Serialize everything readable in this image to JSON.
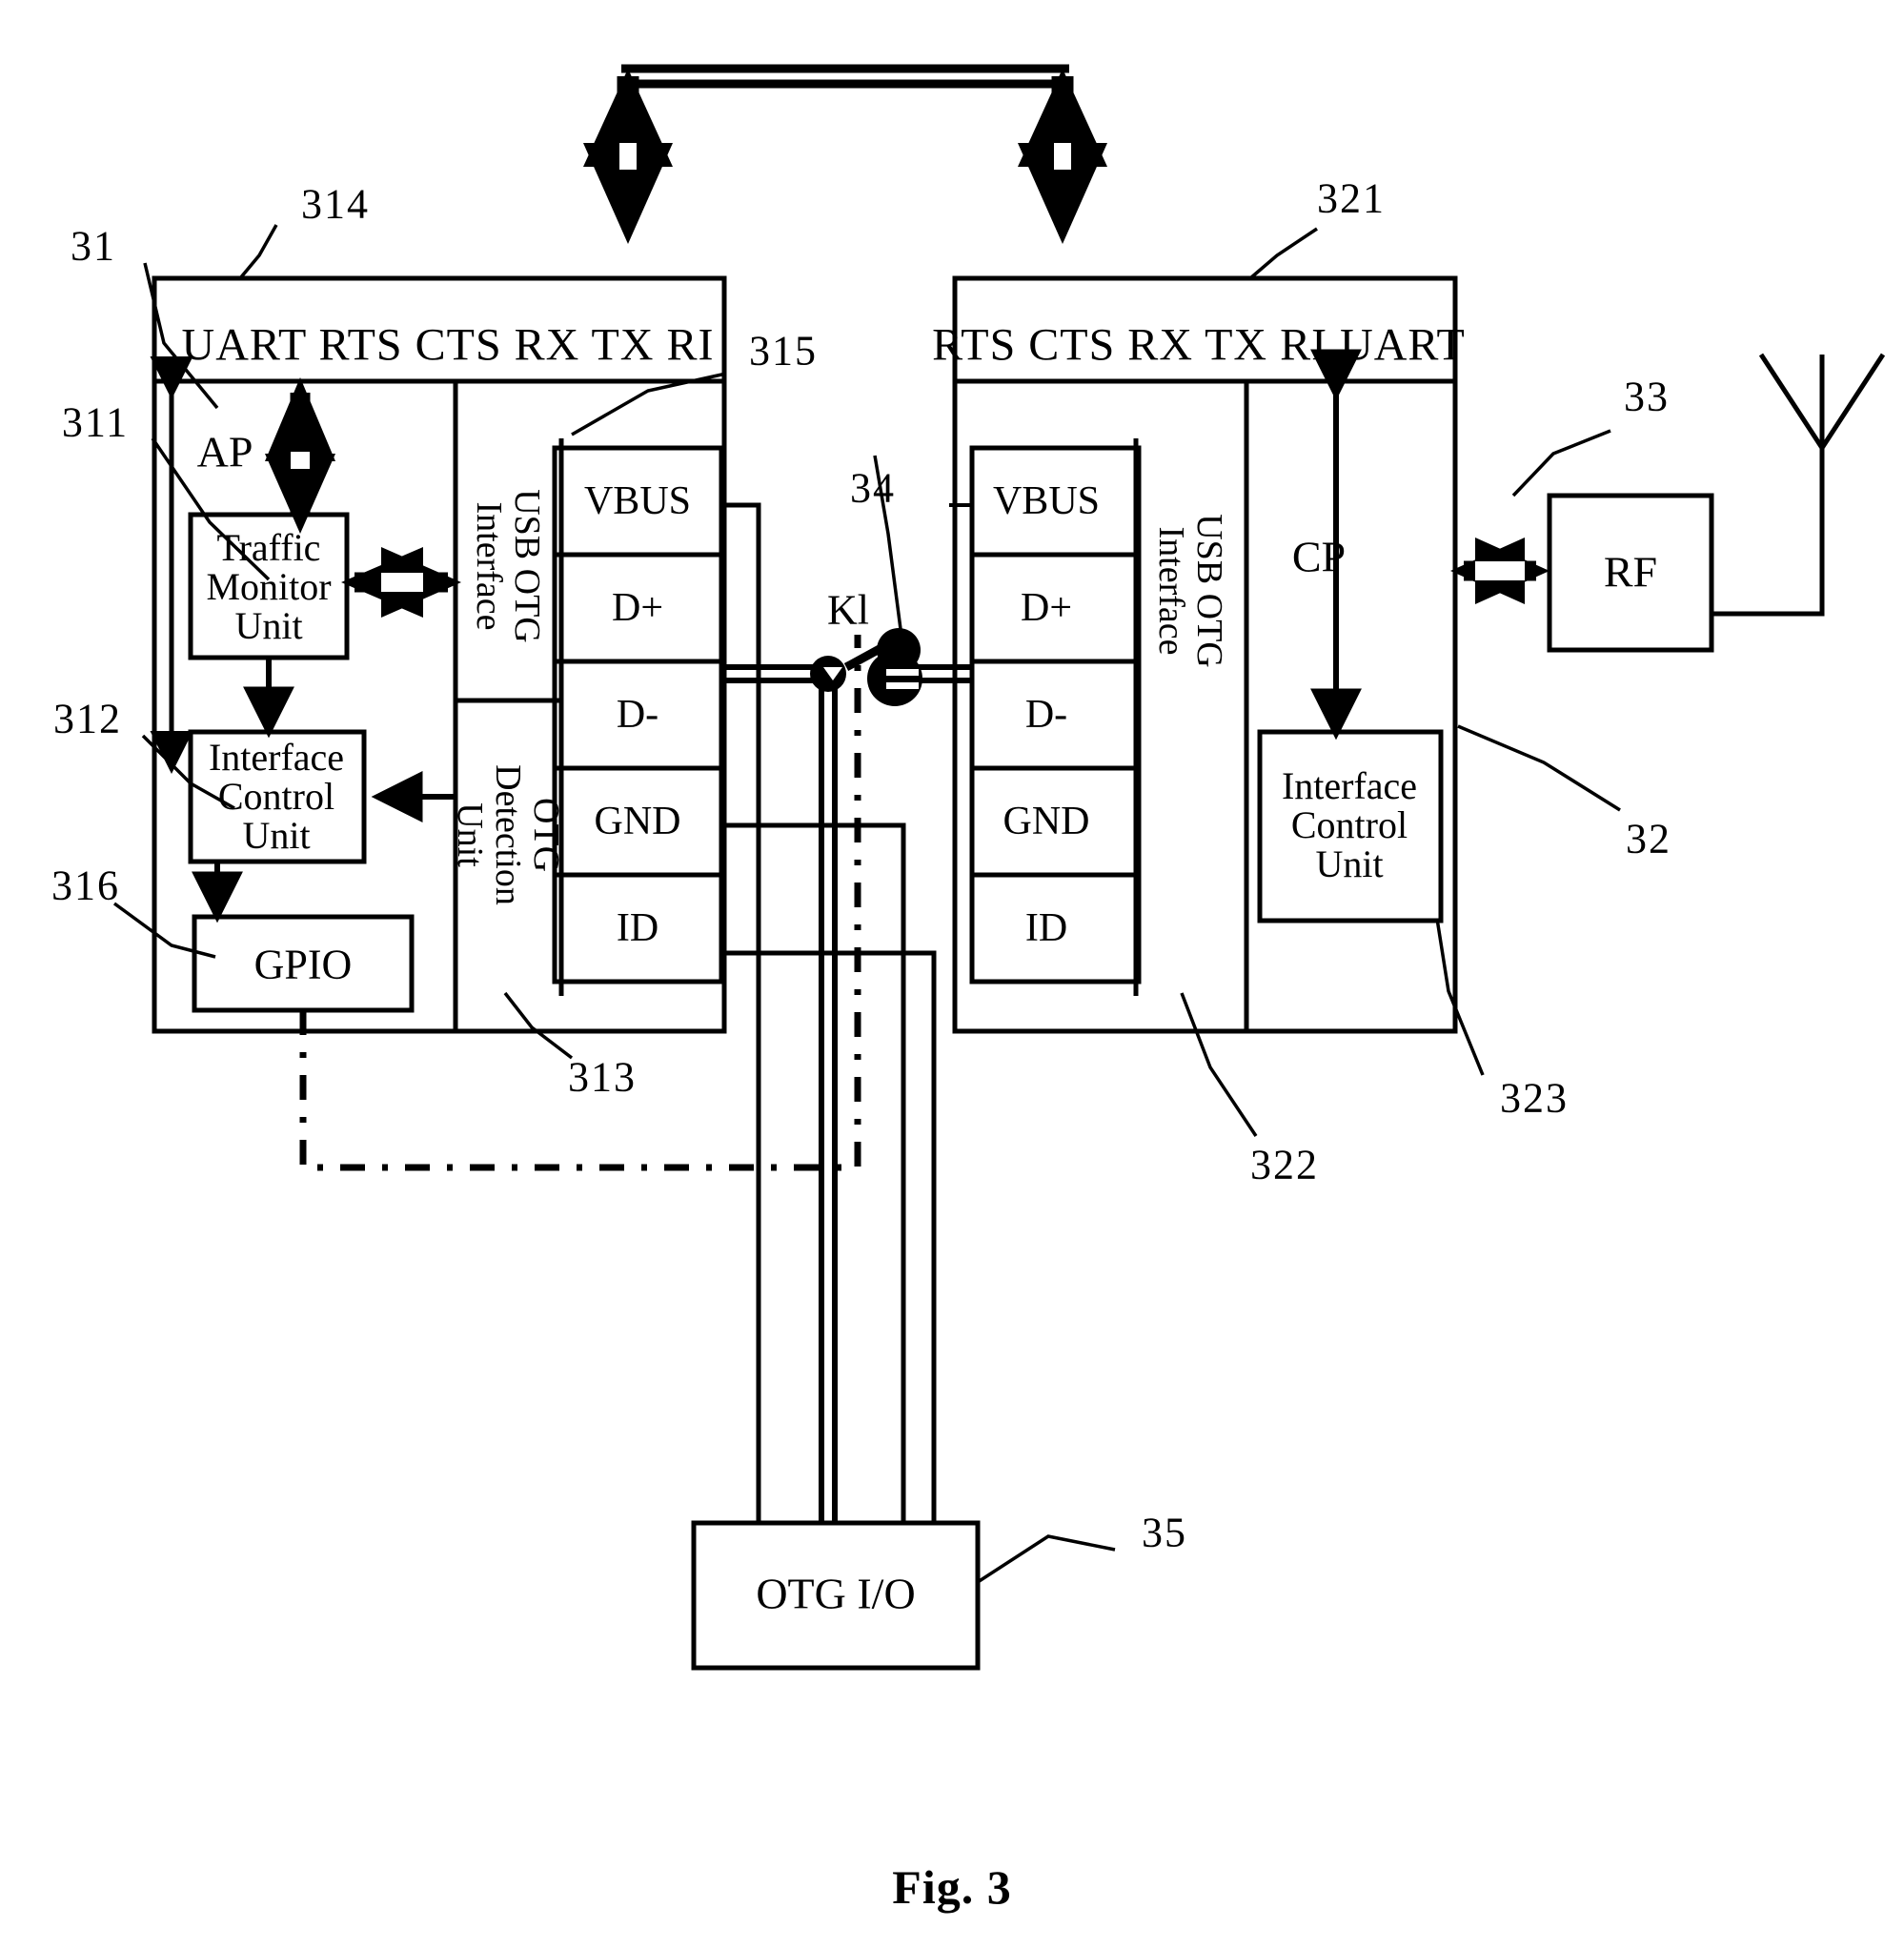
{
  "figure": {
    "caption": "Fig. 3"
  },
  "left_block": {
    "ref": "31",
    "uart_header": "UART  RTS CTS RX TX RI",
    "uart_header_ref": "314",
    "ap_label": "AP",
    "ap_ref": "311",
    "traffic_monitor_unit": "Traffic\nMonitor\nUnit",
    "interface_control_unit": "Interface\nControl\nUnit",
    "interface_control_unit_ref": "312",
    "gpio_label": "GPIO",
    "gpio_ref": "316",
    "usb_otg_interface": "USB OTG\nInterface",
    "usb_otg_interface_ref": "315",
    "otg_detection_unit": "OTG\nDetection\nUnit",
    "otg_detection_unit_ref": "313",
    "pins": [
      "VBUS",
      "D+",
      "D-",
      "GND",
      "ID"
    ]
  },
  "right_block": {
    "ref": "32",
    "uart_header": "RTS CTS RX  TX  RI UART",
    "uart_header_ref": "321",
    "cp_label": "CP",
    "interface_control_unit": "Interface\nControl\nUnit",
    "interface_control_unit_ref": "323",
    "usb_otg_interface": "USB OTG\nInterface",
    "usb_otg_interface_ref": "322",
    "pins": [
      "VBUS",
      "D+",
      "D-",
      "GND",
      "ID"
    ]
  },
  "switch": {
    "label": "Kl",
    "ref": "34"
  },
  "rf": {
    "label": "RF",
    "ref": "33"
  },
  "antenna": {
    "name": "antenna-symbol"
  },
  "otg_io": {
    "label": "OTG I/O",
    "ref": "35"
  }
}
